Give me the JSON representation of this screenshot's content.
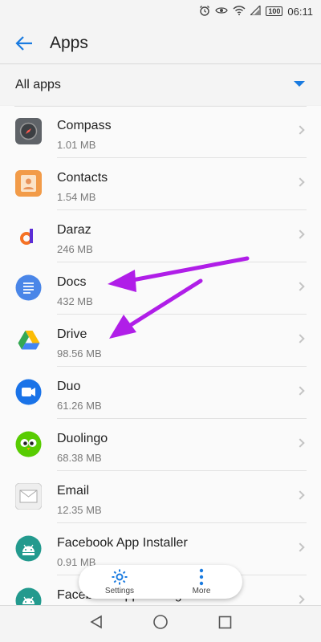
{
  "status_bar": {
    "time": "06:11",
    "battery": "100",
    "icons": [
      "alarm-icon",
      "eye-icon",
      "wifi-icon",
      "signal-icon",
      "battery-icon"
    ]
  },
  "header": {
    "title": "Apps",
    "back_icon": "back-arrow-icon"
  },
  "filter": {
    "selected": "All apps",
    "accent": "#1a7be0"
  },
  "apps": [
    {
      "name": "Compass",
      "size": "1.01 MB",
      "icon": "compass-icon"
    },
    {
      "name": "Contacts",
      "size": "1.54 MB",
      "icon": "contacts-icon"
    },
    {
      "name": "Daraz",
      "size": "246 MB",
      "icon": "daraz-icon"
    },
    {
      "name": "Docs",
      "size": "432 MB",
      "icon": "docs-icon"
    },
    {
      "name": "Drive",
      "size": "98.56 MB",
      "icon": "drive-icon"
    },
    {
      "name": "Duo",
      "size": "61.26 MB",
      "icon": "duo-icon"
    },
    {
      "name": "Duolingo",
      "size": "68.38 MB",
      "icon": "duolingo-icon"
    },
    {
      "name": "Email",
      "size": "12.35 MB",
      "icon": "email-icon"
    },
    {
      "name": "Facebook App Installer",
      "size": "0.91 MB",
      "icon": "android-icon"
    },
    {
      "name": "Facebook App Manager",
      "size": "",
      "icon": "android-icon"
    }
  ],
  "bottom_menu": {
    "settings_label": "Settings",
    "more_label": "More"
  },
  "annotation_color": "#b01ee8"
}
